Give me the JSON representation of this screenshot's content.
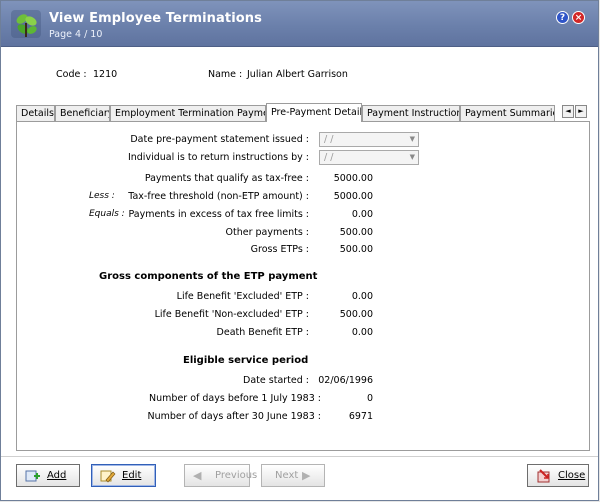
{
  "window": {
    "title": "View Employee Terminations",
    "page_indicator": "Page 4 / 10",
    "help_glyph": "?",
    "close_glyph": "×"
  },
  "employee": {
    "code_label": "Code :",
    "code_value": "1210",
    "name_label": "Name :",
    "name_value": "Julian Albert Garrison"
  },
  "tabs": [
    {
      "label": "Details"
    },
    {
      "label": "Beneficiary"
    },
    {
      "label": "Employment Termination Payments"
    },
    {
      "label": "Pre-Payment Details",
      "active": true
    },
    {
      "label": "Payment Instructions"
    },
    {
      "label": "Payment Summaries"
    }
  ],
  "tab_scroll": {
    "left": "◄",
    "right": "►"
  },
  "form": {
    "statement_issued": {
      "label": "Date pre-payment statement issued :",
      "value": " /  /"
    },
    "return_instructions": {
      "label": "Individual is to return instructions by :",
      "value": " /  /"
    },
    "qualify_tax_free": {
      "label": "Payments that qualify as tax-free :",
      "value": "5000.00"
    },
    "less_prefix": "Less :",
    "tax_free_threshold": {
      "label": "Tax-free threshold (non-ETP amount) :",
      "value": "5000.00"
    },
    "equals_prefix": "Equals :",
    "excess": {
      "label": "Payments in excess of tax free limits :",
      "value": "0.00"
    },
    "other_payments": {
      "label": "Other payments :",
      "value": "500.00"
    },
    "gross_etps": {
      "label": "Gross ETPs :",
      "value": "500.00"
    }
  },
  "gross_components": {
    "heading": "Gross components of the ETP payment",
    "life_excluded": {
      "label": "Life Benefit 'Excluded' ETP :",
      "value": "0.00"
    },
    "life_non_excluded": {
      "label": "Life Benefit 'Non-excluded' ETP :",
      "value": "500.00"
    },
    "death_benefit": {
      "label": "Death Benefit ETP :",
      "value": "0.00"
    }
  },
  "service_period": {
    "heading": "Eligible service period",
    "date_started": {
      "label": "Date started :",
      "value": "02/06/1996"
    },
    "days_before": {
      "label": "Number of days before 1 July 1983 :",
      "value": "0"
    },
    "days_after": {
      "label": "Number of days after 30 June 1983 :",
      "value": "6971"
    }
  },
  "buttons": {
    "add": "Add",
    "edit": "Edit",
    "previous": "Previous",
    "next": "Next",
    "close": "Close"
  },
  "colors": {
    "titlebar": "#6b80ab",
    "help": "#2f55c8",
    "close": "#d22727"
  }
}
